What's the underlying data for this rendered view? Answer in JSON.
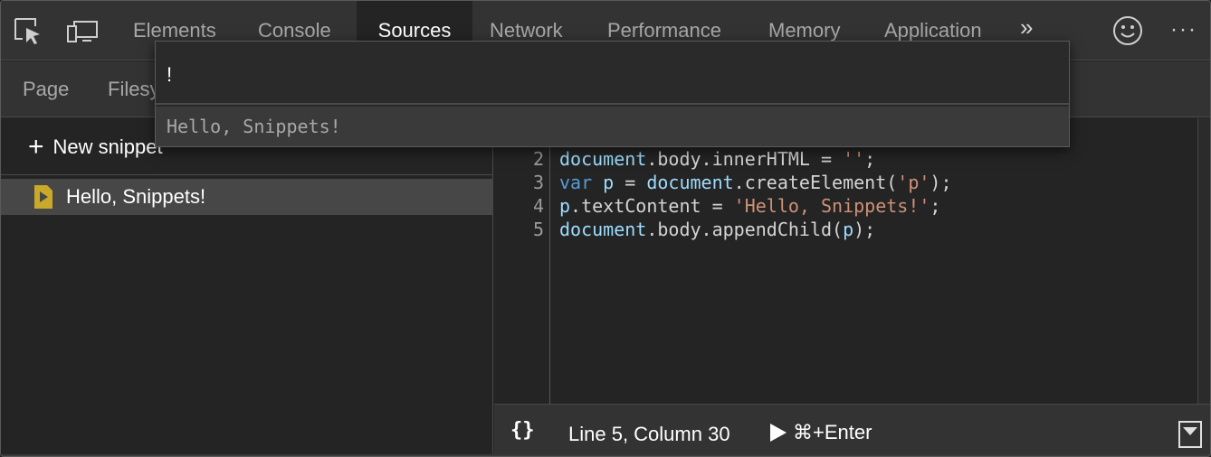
{
  "tabs": [
    {
      "label": "Elements"
    },
    {
      "label": "Console"
    },
    {
      "label": "Sources",
      "active": true
    },
    {
      "label": "Network"
    },
    {
      "label": "Performance"
    },
    {
      "label": "Memory"
    },
    {
      "label": "Application"
    }
  ],
  "more_tabs_glyph": "»",
  "menu_glyph": "···",
  "subtabs": [
    {
      "label": "Page"
    },
    {
      "label": "Filesy"
    }
  ],
  "navigator": {
    "new_snippet_plus": "+",
    "new_snippet_label": "New snippet",
    "snippet_item": "Hello, Snippets!"
  },
  "editor": {
    "line_numbers": [
      "2",
      "3",
      "4",
      "5"
    ],
    "lines": [
      [
        {
          "t": "document",
          "c": "var"
        },
        {
          "t": ".body.innerHTML = ",
          "c": "plain"
        },
        {
          "t": "''",
          "c": "str"
        },
        {
          "t": ";",
          "c": "plain"
        }
      ],
      [
        {
          "t": "var",
          "c": "kw"
        },
        {
          "t": " ",
          "c": "plain"
        },
        {
          "t": "p",
          "c": "var"
        },
        {
          "t": " = ",
          "c": "plain"
        },
        {
          "t": "document",
          "c": "var"
        },
        {
          "t": ".createElement(",
          "c": "plain"
        },
        {
          "t": "'p'",
          "c": "str"
        },
        {
          "t": ");",
          "c": "plain"
        }
      ],
      [
        {
          "t": "p",
          "c": "var"
        },
        {
          "t": ".textContent = ",
          "c": "plain"
        },
        {
          "t": "'Hello, Snippets!'",
          "c": "str"
        },
        {
          "t": ";",
          "c": "plain"
        }
      ],
      [
        {
          "t": "document",
          "c": "var"
        },
        {
          "t": ".body.appendChild(",
          "c": "plain"
        },
        {
          "t": "p",
          "c": "var"
        },
        {
          "t": ");",
          "c": "plain"
        }
      ]
    ]
  },
  "status": {
    "pretty_print": "{}",
    "cursor_position": "Line 5, Column 30",
    "run_shortcut": "⌘+Enter"
  },
  "quick_open": {
    "query": "!",
    "result": "Hello, Snippets!"
  },
  "colors": {
    "background": "#242424",
    "toolbar": "#333333",
    "selected_item": "#474747",
    "code_identifier": "#9cdcfe",
    "code_keyword": "#569cd6",
    "code_string": "#ce9178",
    "snippet_icon": "#c8a92a"
  },
  "icons": [
    "inspect-element-icon",
    "device-toolbar-icon",
    "feedback-smiley-icon",
    "snippet-file-icon",
    "run-play-icon",
    "toggle-drawer-icon"
  ]
}
